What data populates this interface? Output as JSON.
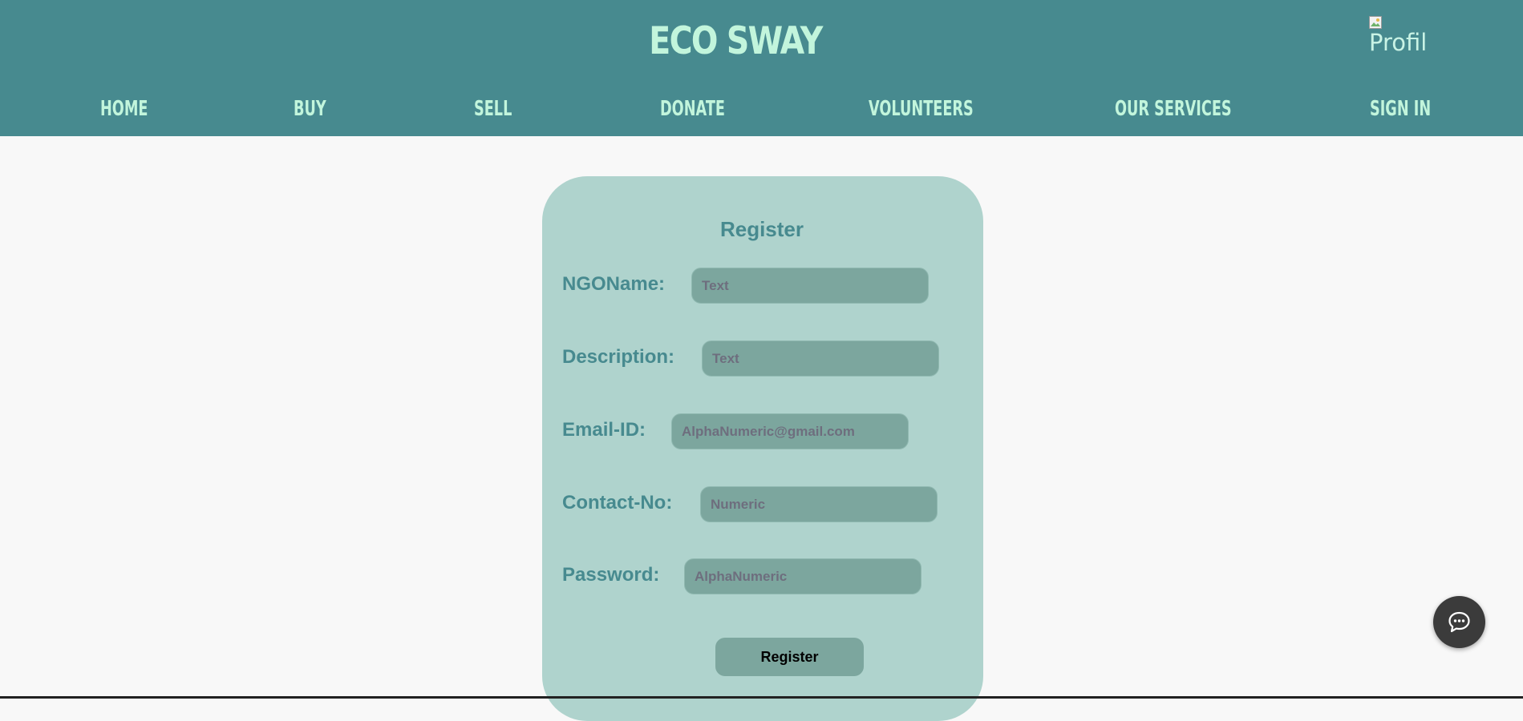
{
  "header": {
    "brand": "ECO SWAY",
    "profile_alt": "Profile"
  },
  "nav": {
    "home": "HOME",
    "buy": "BUY",
    "sell": "SELL",
    "donate": "DONATE",
    "volunteers": "VOLUNTEERS",
    "our_services": "OUR SERVICES",
    "sign_in": "SIGN IN"
  },
  "form": {
    "title": "Register",
    "fields": {
      "ngo_name": {
        "label": "NGOName:",
        "placeholder": "Text"
      },
      "description": {
        "label": "Description:",
        "placeholder": "Text"
      },
      "email": {
        "label": "Email-ID:",
        "placeholder": "AlphaNumeric@gmail.com"
      },
      "contact": {
        "label": "Contact-No:",
        "placeholder": "Numeric"
      },
      "password": {
        "label": "Password:",
        "placeholder": "AlphaNumeric"
      }
    },
    "submit_label": "Register"
  },
  "chat": {
    "icon": "chat-bubble-icon"
  },
  "colors": {
    "header_bg": "#478a8f",
    "accent_text": "#c2f5dc",
    "card_bg": "#afd3cd",
    "input_bg": "#7ca69e",
    "label_text": "#478a8f",
    "page_bg": "#f8f8f8",
    "chat_bg": "#3b3b3b"
  }
}
